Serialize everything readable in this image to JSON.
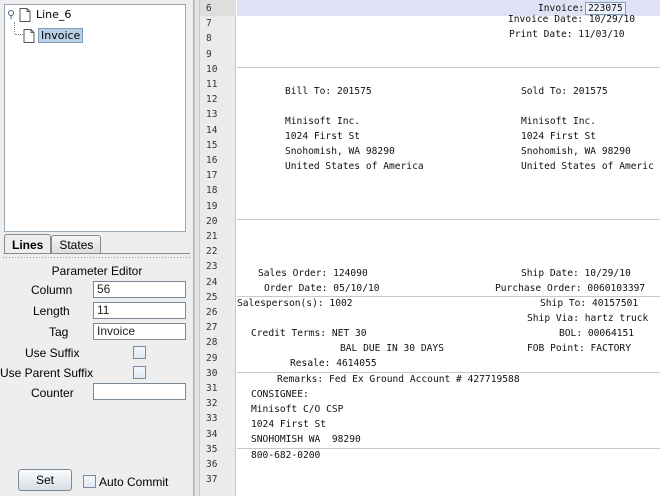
{
  "tree": {
    "root_label": "Line_6",
    "child_label": "Invoice"
  },
  "tabs": [
    {
      "label": "Lines",
      "active": true
    },
    {
      "label": "States",
      "active": false
    }
  ],
  "editor": {
    "title": "Parameter Editor",
    "column_label": "Column",
    "column_value": "56",
    "length_label": "Length",
    "length_value": "11",
    "tag_label": "Tag",
    "tag_value": "Invoice",
    "use_suffix_label": "Use Suffix",
    "use_parent_suffix_label": "Use Parent Suffix",
    "counter_label": "Counter",
    "counter_value": "",
    "set_label": "Set",
    "auto_commit_label": "Auto Commit"
  },
  "line_numbers": [
    "6",
    "7",
    "8",
    "9",
    "10",
    "11",
    "12",
    "13",
    "14",
    "15",
    "16",
    "17",
    "18",
    "19",
    "20",
    "21",
    "22",
    "23",
    "24",
    "25",
    "26",
    "27",
    "28",
    "29",
    "30",
    "31",
    "32",
    "33",
    "34",
    "35",
    "36",
    "37"
  ],
  "document": {
    "invoice_label": "Invoice:",
    "invoice_value": "223075",
    "line7": "Invoice Date: 10/29/10",
    "line8": "Print Date: 11/03/10",
    "bill_to": "Bill To: 201575",
    "sold_to": "Sold To: 201575",
    "bill_name": "Minisoft Inc.",
    "sold_name": "Minisoft Inc.",
    "bill_street": "1024 First St",
    "sold_street": "1024 First St",
    "bill_city": "Snohomish, WA 98290",
    "sold_city": "Snohomish, WA 98290",
    "bill_country": "United States of America",
    "sold_country": "United States of Americ",
    "sales_order": "Sales Order: 124090",
    "ship_date": "Ship Date: 10/29/10",
    "order_date": "Order Date: 05/10/10",
    "purchase_order": "Purchase Order: 0060103397",
    "salesperson": "Salesperson(s): 1002",
    "ship_to": "Ship To: 40157501",
    "ship_via": "Ship Via: hartz truck",
    "credit_terms": "Credit Terms: NET 30",
    "bol": "BOL: 00064151",
    "bal_due": "BAL DUE IN 30 DAYS",
    "fob": "FOB Point: FACTORY",
    "resale": "Resale: 4614055",
    "remarks": "Remarks: Fed Ex Ground Account # 427719588",
    "consignee": "CONSIGNEE:",
    "cons_name": "Minisoft C/O CSP",
    "cons_street": "1024 First St",
    "cons_city": "SNOHOMISH WA  98290",
    "cons_phone": "800-682-0200"
  }
}
